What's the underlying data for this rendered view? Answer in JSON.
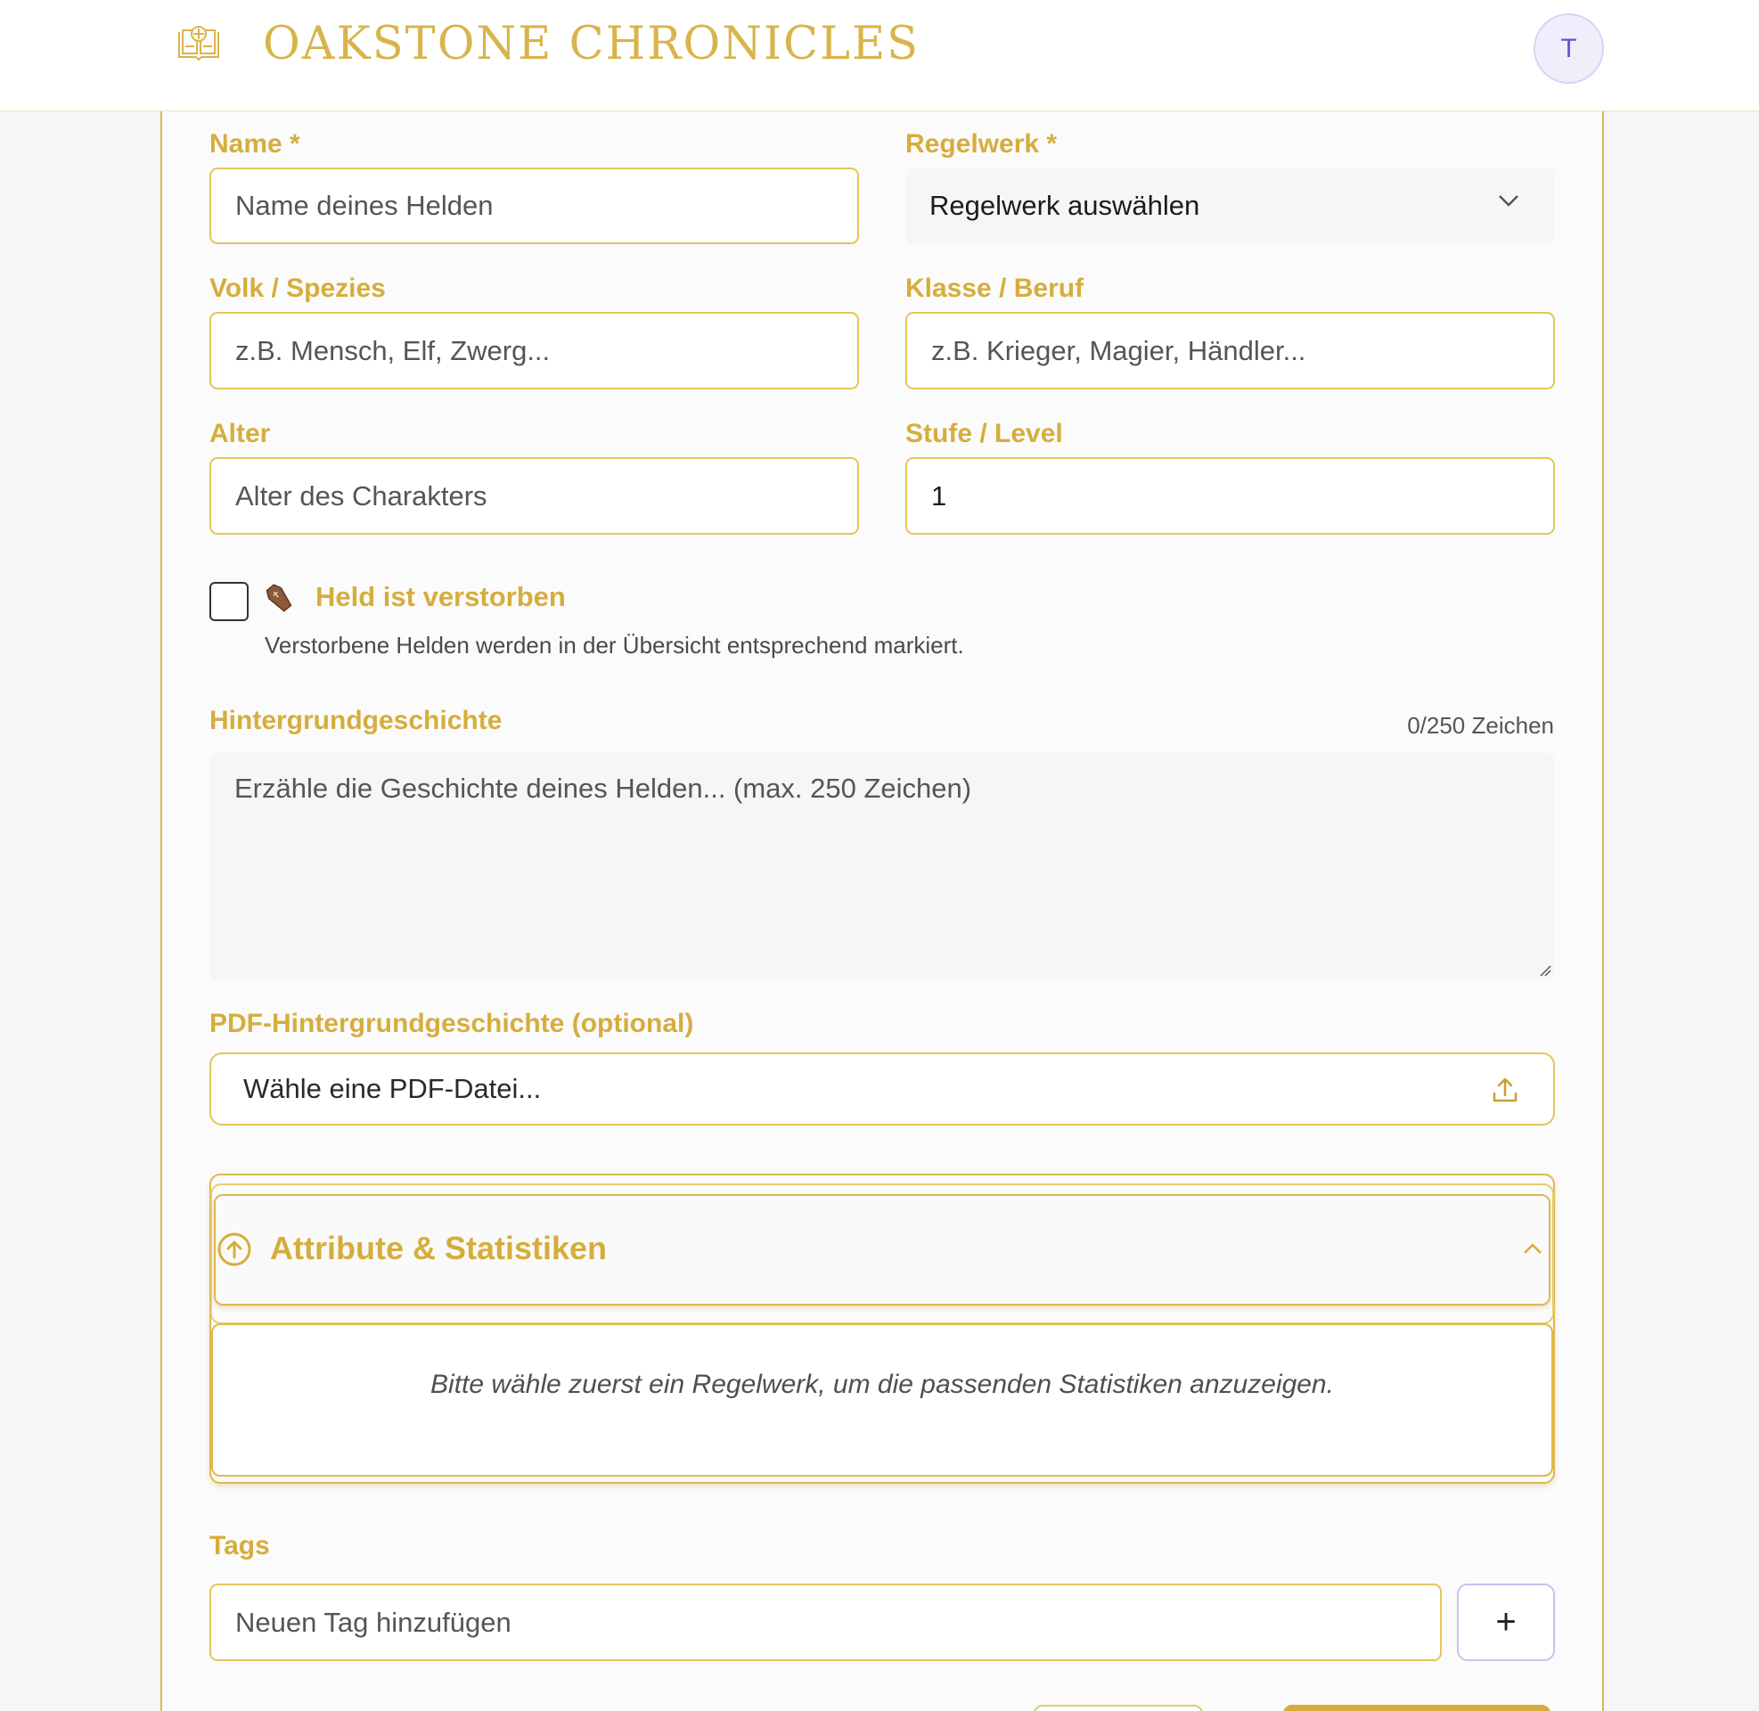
{
  "header": {
    "brand": "OAKSTONE CHRONICLES",
    "logo_icon": "book-icon",
    "avatar_initial": "T"
  },
  "colors": {
    "accent": "#d6ad3d",
    "border": "#e6c45a",
    "avatar_bg": "#f1eefc",
    "avatar_text": "#6b4fd8"
  },
  "form": {
    "name": {
      "label": "Name *",
      "placeholder": "Name deines Helden"
    },
    "ruleset": {
      "label": "Regelwerk *",
      "value": "Regelwerk auswählen"
    },
    "species": {
      "label": "Volk / Spezies",
      "placeholder": "z.B. Mensch, Elf, Zwerg..."
    },
    "class": {
      "label": "Klasse / Beruf",
      "placeholder": "z.B. Krieger, Magier, Händler..."
    },
    "age": {
      "label": "Alter",
      "placeholder": "Alter des Charakters"
    },
    "level": {
      "label": "Stufe / Level",
      "value": "1"
    },
    "deceased": {
      "label": "Held ist verstorben",
      "icon": "coffin-icon",
      "checked": false,
      "help": "Verstorbene Helden werden in der Übersicht entsprechend markiert."
    },
    "backstory": {
      "label": "Hintergrundgeschichte",
      "counter": "0/250 Zeichen",
      "placeholder": "Erzähle die Geschichte deines Helden... (max. 250 Zeichen)"
    },
    "pdf": {
      "label": "PDF-Hintergrundgeschichte (optional)",
      "placeholder": "Wähle eine PDF-Datei..."
    },
    "attributes": {
      "title": "Attribute & Statistiken",
      "message": "Bitte wähle zuerst ein Regelwerk, um die passenden Statistiken anzuzeigen."
    },
    "tags": {
      "label": "Tags",
      "placeholder": "Neuen Tag hinzufügen",
      "add_label": "+"
    }
  }
}
